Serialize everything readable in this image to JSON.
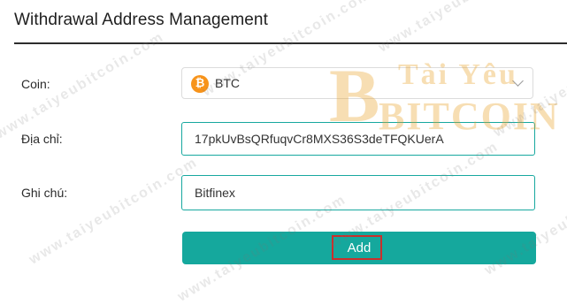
{
  "header": {
    "title": "Withdrawal Address Management"
  },
  "form": {
    "coin_label": "Coin:",
    "coin_icon": "bitcoin-icon",
    "coin_symbol": "₿",
    "coin_value": "BTC",
    "address_label": "Địa chỉ:",
    "address_value": "17pkUvBsQRfuqvCr8MXS36S3deTFQKUerA",
    "note_label": "Ghi chú:",
    "note_value": "Bitfinex",
    "add_button": "Add"
  },
  "watermark": {
    "text": "www.taiyeubitcoin.com",
    "logo_top": "Tài Yêu",
    "logo_bottom": "BITCOIN",
    "logo_letter": "B"
  },
  "colors": {
    "accent": "#15a89d",
    "highlight": "#c9302c",
    "bitcoin": "#f7931a",
    "watermark_logo": "#e9a124"
  }
}
